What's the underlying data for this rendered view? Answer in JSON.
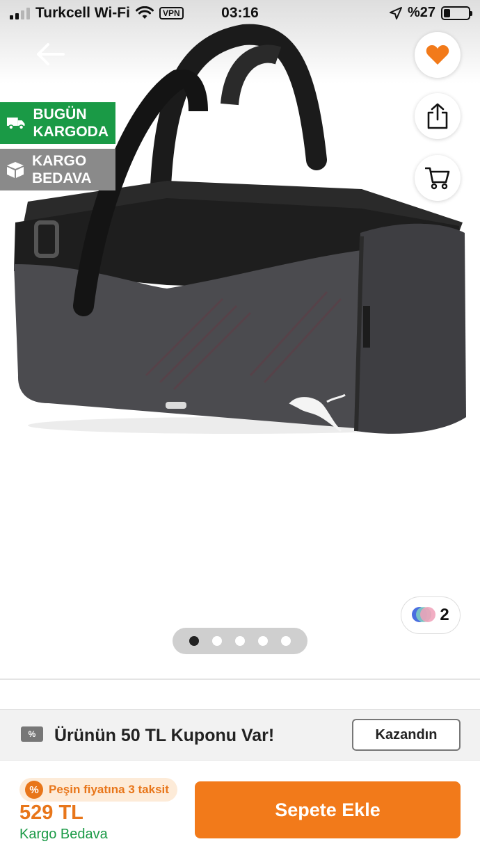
{
  "status_bar": {
    "carrier": "Turkcell Wi-Fi",
    "vpn": "VPN",
    "time": "03:16",
    "battery": "%27",
    "battery_level": 0.27
  },
  "badges": {
    "same_day": {
      "line1": "BUGÜN",
      "line2": "KARGODA",
      "color": "#1a9a46",
      "icon": "truck-icon"
    },
    "free_shipping": {
      "line1": "KARGO",
      "line2": "BEDAVA",
      "color": "#8a8a8a",
      "icon": "box-icon"
    }
  },
  "actions": {
    "back_icon": "arrow-left-icon",
    "favorite_icon": "heart-icon",
    "share_icon": "share-icon",
    "cart_icon": "cart-icon",
    "favorite_color": "#f27a1a"
  },
  "gallery": {
    "color_variants_count": "2",
    "page_count": 5,
    "active_page": 1
  },
  "coupon": {
    "text": "Ürünün 50 TL Kuponu Var!",
    "button_label": "Kazandın"
  },
  "purchase": {
    "installment_text": "Peşin fiyatına 3 taksit",
    "price": "529 TL",
    "shipping": "Kargo Bedava",
    "add_to_cart_label": "Sepete Ekle",
    "accent_color": "#f27a1a"
  }
}
